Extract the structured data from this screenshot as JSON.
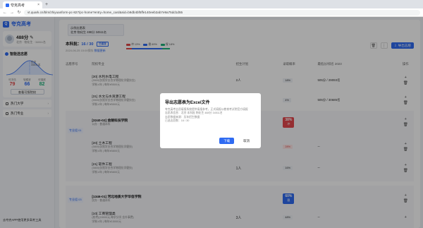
{
  "browser": {
    "tab_title": "夸克高考",
    "url": "vt.quark.cn/blm/zhiyuanform-pc-827/pc-home?entry=home_card&sid=b9db4bf5ffe140eeb2ab7e9a75dd1d55"
  },
  "sidebar": {
    "logo_text": "夸克高考",
    "score": "488分",
    "profile_sub": "北京 · 物化生 · 34511名",
    "wishlist_title": "智能选志愿",
    "curve_rank": "位次",
    "curve_label": "34511名",
    "stats": [
      {
        "label": "可冲击",
        "value": "79",
        "color": "#e04848"
      },
      {
        "label": "较稳妥",
        "value": "66",
        "color": "#2f6bf2"
      },
      {
        "label": "可保底",
        "value": "82",
        "color": "#1db37c"
      }
    ],
    "view_button": "查看可报院校",
    "nav": [
      {
        "label": "热门大学"
      },
      {
        "label": "热门专业"
      }
    ],
    "footer": "去夸克APP使用更多高考工具"
  },
  "main": {
    "tip_line1": "示例志愿表",
    "tip_line2": "北京 物化生 488分 34511名",
    "title_prefix": "本科批：",
    "title_count": "16 / 30",
    "title_tag": "已保存",
    "updated": "2024-06-25 15:00保存",
    "updated_link": "数据更新",
    "legend": [
      {
        "label": "冲 13%",
        "color": "#e04848"
      },
      {
        "label": "稳 69%",
        "color": "#2f6bf2"
      },
      {
        "label": "保 18%",
        "color": "#1db37c"
      }
    ],
    "progress": [
      0.13,
      0.69,
      0.18
    ],
    "export_label": "导出志愿",
    "columns": [
      "志愿序号",
      "院校专业",
      "招生计划",
      "录取概率",
      "最低分/排名 2023",
      "操作"
    ],
    "rows": [
      {
        "name": "[30] 水利水电工程",
        "sub1": "(5500)仅限学业合学物理化学健技应)",
        "sub2": "学制:4年 | 每年¥5500元",
        "plan": "2人",
        "pct": "18%",
        "score": "505分 / 29093名",
        "red": false
      },
      {
        "name": "[31] 水文与水资源工程",
        "sub1": "(5500)仅限学业合学物理化学健技应)",
        "sub2": "学制:4年 | 每年¥5500元",
        "plan": "",
        "pct": "4%",
        "score": "505分 / 30685名",
        "red": false
      },
      {
        "name": "[20] 土木工程",
        "sub1": "(5800)仅限学业合学物理化学健技)",
        "sub2": "学制:4年 | 每年¥5800元",
        "plan": "",
        "pct": "28%",
        "score": "--",
        "red": true
      },
      {
        "name": "[21] 软件工程",
        "sub1": "(5800)仅限学业合学物理化学健技)",
        "sub2": "学制:4年 | 每年¥5800元",
        "plan": "1人",
        "pct": "16%",
        "score": "--",
        "red": false
      },
      {
        "name": "[10] 工商管理类",
        "sub1": "(校考)(15000元,每学分学,含外事费)",
        "sub2": "学制:4年 | 每年¥15000元",
        "plan": "3人",
        "pct": "48%",
        "score": "--",
        "red": false
      }
    ],
    "groups": [
      {
        "tag": "专业组 01",
        "school": "[3240-02] 金陵科技学院",
        "meta": "公办 · 普通本科",
        "rate": "38%",
        "rate_sub": "冲",
        "rate_color": "#e5484d"
      },
      {
        "tag": "专业组 03",
        "school": "[1346-01] 河北地质大学华信学院",
        "meta": "民办 · 普通本科",
        "rate": "60%",
        "rate_sub": "稳",
        "rate_color": "#2f6bf2"
      }
    ]
  },
  "modal": {
    "title": "导出志愿表为Excel文件",
    "desc1": "夸克高考志愿填报系统提供填报参考，正式填报以教育考试院官方填报",
    "desc2": "志愿表信息：北京 本科批 物化生 488分 34511名",
    "desc3": "志愿数据来源：历年招生数据",
    "desc4": "已选志愿数：16 / 30",
    "confirm": "下载",
    "cancel": "取消"
  }
}
